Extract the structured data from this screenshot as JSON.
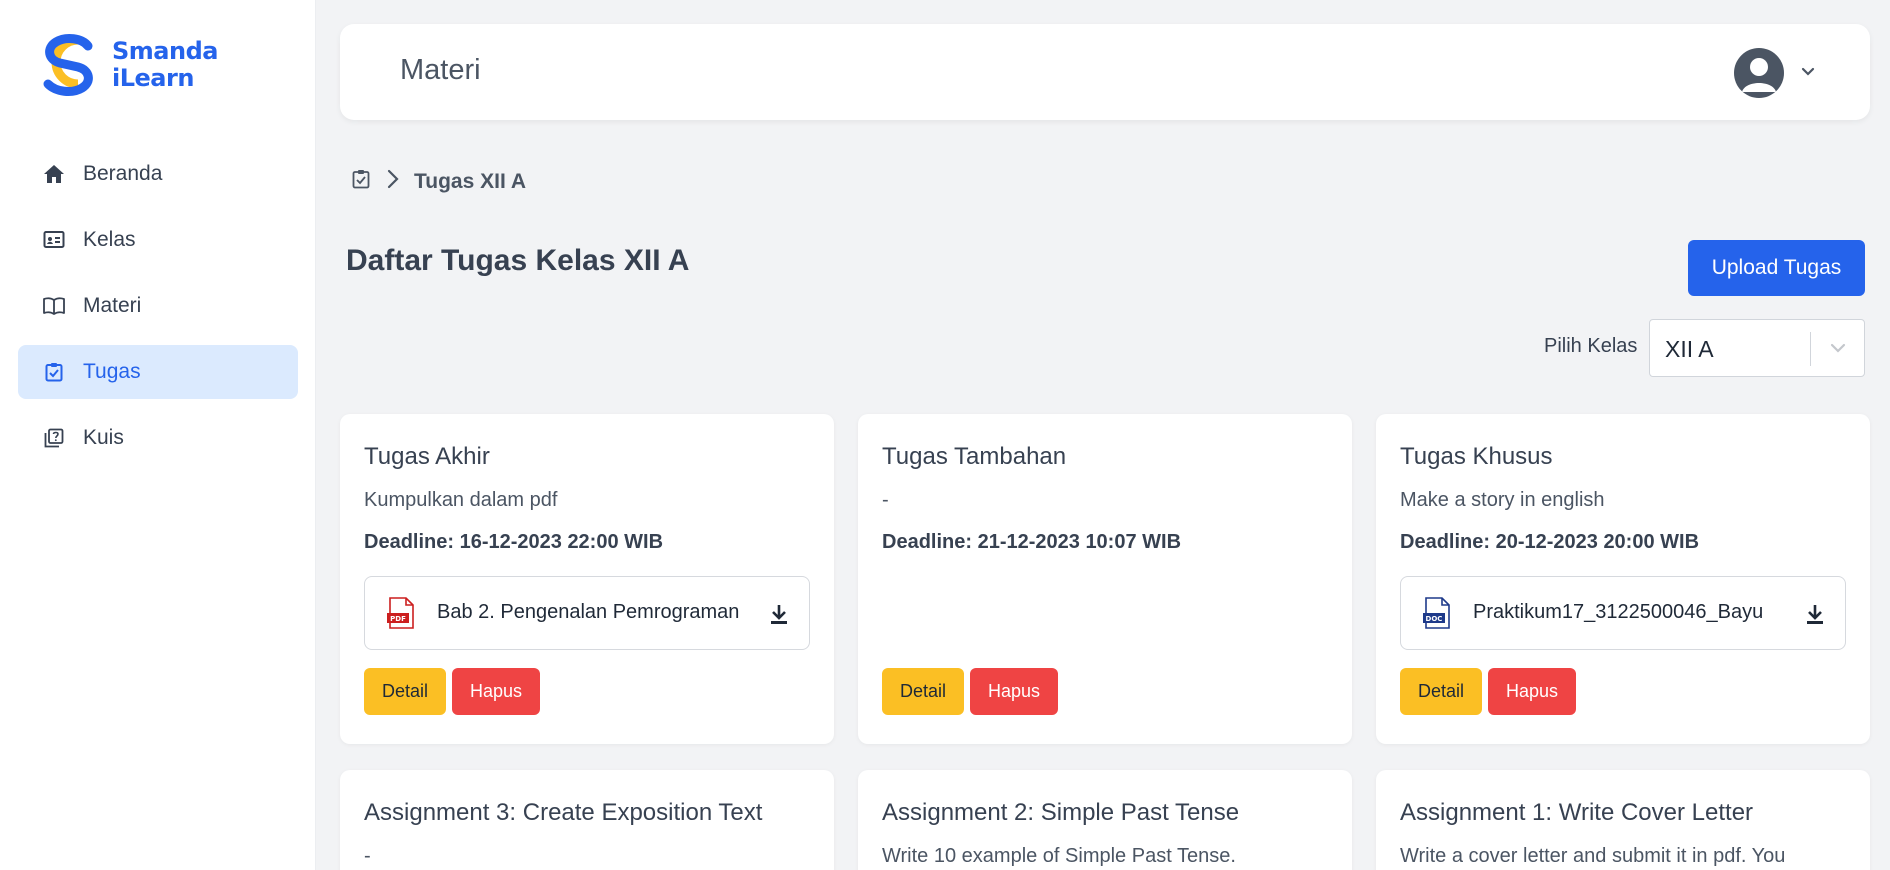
{
  "brand": {
    "name_line1": "Smanda",
    "name_line2": "iLearn",
    "primary": "#2563eb",
    "accent": "#fbbf24"
  },
  "sidebar": {
    "items": [
      {
        "label": "Beranda",
        "icon": "home-icon",
        "active": false
      },
      {
        "label": "Kelas",
        "icon": "class-board-icon",
        "active": false
      },
      {
        "label": "Materi",
        "icon": "book-open-icon",
        "active": false
      },
      {
        "label": "Tugas",
        "icon": "clipboard-check-icon",
        "active": true
      },
      {
        "label": "Kuis",
        "icon": "quiz-icon",
        "active": false
      }
    ]
  },
  "header": {
    "title": "Materi",
    "avatar_icon": "user-avatar-icon",
    "menu_icon": "chevron-down-icon"
  },
  "breadcrumb": {
    "icon": "clipboard-check-icon",
    "separator_icon": "chevron-right-icon",
    "current": "Tugas XII A"
  },
  "main": {
    "title": "Daftar Tugas Kelas XII A",
    "upload_label": "Upload Tugas",
    "filter": {
      "label": "Pilih Kelas",
      "selected": "XII A"
    }
  },
  "actions": {
    "detail_label": "Detail",
    "delete_label": "Hapus"
  },
  "cards": [
    {
      "title": "Tugas Akhir",
      "description": "Kumpulkan dalam pdf",
      "deadline": "Deadline: 16-12-2023 22:00 WIB",
      "file": {
        "name": "Bab 2. Pengenalan Pemrograman",
        "type": "PDF"
      }
    },
    {
      "title": "Tugas Tambahan",
      "description": "-",
      "deadline": "Deadline: 21-12-2023 10:07 WIB",
      "file": null
    },
    {
      "title": "Tugas Khusus",
      "description": "Make a story in english",
      "deadline": "Deadline: 20-12-2023 20:00 WIB",
      "file": {
        "name": "Praktikum17_3122500046_Bayu",
        "type": "DOC"
      }
    },
    {
      "title": "Assignment 3: Create Exposition Text",
      "description": "-"
    },
    {
      "title": "Assignment 2: Simple Past Tense",
      "description": "Write 10 example of Simple Past Tense."
    },
    {
      "title": "Assignment 1: Write Cover Letter",
      "description": "Write a cover letter and submit it in pdf. You"
    }
  ]
}
